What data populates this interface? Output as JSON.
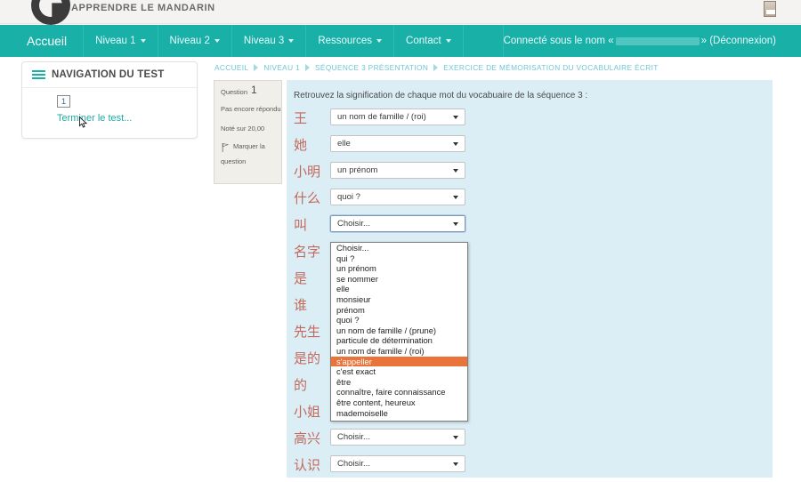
{
  "header": {
    "site_title": "APPRENDRE LE MANDARIN",
    "logo_icon": "panda-logo-icon",
    "avatar_icon": "user-avatar-icon"
  },
  "navbar": {
    "items": [
      {
        "label": "Accueil",
        "has_caret": false
      },
      {
        "label": "Niveau 1",
        "has_caret": true
      },
      {
        "label": "Niveau 2",
        "has_caret": true
      },
      {
        "label": "Niveau 3",
        "has_caret": true
      },
      {
        "label": "Ressources",
        "has_caret": true
      },
      {
        "label": "Contact",
        "has_caret": true
      }
    ],
    "user_prefix": "Connecté sous le nom «",
    "user_name": "",
    "user_suffix": "» (Déconnexion)"
  },
  "test_navigation": {
    "title": "NAVIGATION DU TEST",
    "menu_icon": "hamburger-icon",
    "question_number": "1",
    "finish_label": "Terminer le test..."
  },
  "breadcrumb": {
    "items": [
      "ACCUEIL",
      "NIVEAU 1",
      "SÉQUENCE 3 PRÉSENTATION",
      "EXERCICE DE MÉMORISATION DU VOCABULAIRE ÉCRIT"
    ]
  },
  "question_info": {
    "label": "Question",
    "number": "1",
    "state": "Pas encore répondu",
    "marks": "Noté sur 20,00",
    "flag_icon": "flag-icon",
    "flag_label_line1": "Marquer la",
    "flag_label_line2": "question"
  },
  "question": {
    "prompt": "Retrouvez la signification de chaque mot du vocabuaire de la séquence 3 :",
    "placeholder": "Choisir...",
    "rows": [
      {
        "hanzi": "王",
        "value": "un nom de famille / (roi)",
        "open": false
      },
      {
        "hanzi": "她",
        "value": "elle",
        "open": false
      },
      {
        "hanzi": "小明",
        "value": "un prénom",
        "open": false
      },
      {
        "hanzi": "什么",
        "value": "quoi ?",
        "open": false
      },
      {
        "hanzi": "叫",
        "value": "Choisir...",
        "open": true
      },
      {
        "hanzi": "名字",
        "value": "Choisir...",
        "open": false
      },
      {
        "hanzi": "是",
        "value": "Choisir...",
        "open": false
      },
      {
        "hanzi": "谁",
        "value": "Choisir...",
        "open": false
      },
      {
        "hanzi": "先生",
        "value": "Choisir...",
        "open": false
      },
      {
        "hanzi": "是的",
        "value": "Choisir...",
        "open": false
      },
      {
        "hanzi": "的",
        "value": "Choisir...",
        "open": false
      },
      {
        "hanzi": "小姐",
        "value": "Choisir...",
        "open": false
      },
      {
        "hanzi": "高兴",
        "value": "Choisir...",
        "open": false
      },
      {
        "hanzi": "认识",
        "value": "Choisir...",
        "open": false
      }
    ]
  },
  "dropdown": {
    "selected_index": 11,
    "options": [
      "Choisir...",
      "qui ?",
      "un prénom",
      "se nommer",
      "elle",
      "monsieur",
      "prénom",
      "quoi ?",
      "un nom de famille / (prune)",
      "particule de détermination",
      "un nom de famille / (roi)",
      "s'appeller",
      "c'est exact",
      "être",
      "connaître, faire connaissance",
      "être content, heureux",
      "mademoiselle"
    ]
  },
  "colors": {
    "brand_teal": "#19b0a8",
    "panel_blue": "#dceef5",
    "highlight_orange": "#e8743b",
    "hanzi_red": "#c2685c",
    "link_teal": "#1fa8a0",
    "breadcrumb_blue": "#6fc6d9"
  }
}
